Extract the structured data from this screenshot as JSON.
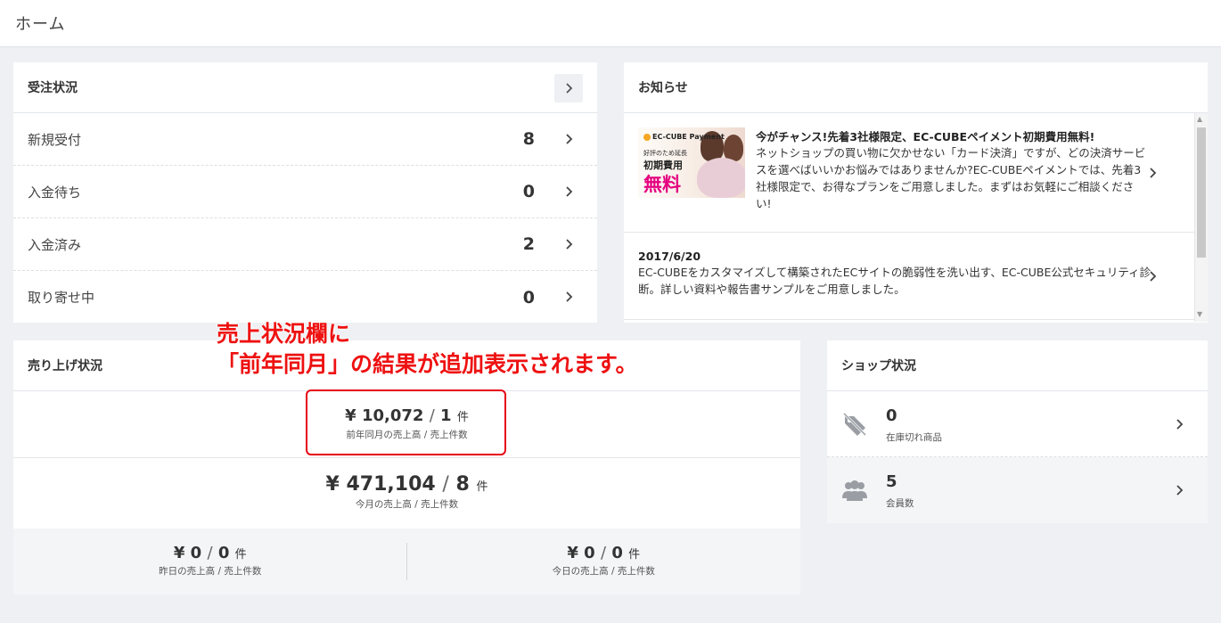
{
  "header": {
    "title": "ホーム"
  },
  "orders": {
    "title": "受注状況",
    "rows": [
      {
        "label": "新規受付",
        "count": "8"
      },
      {
        "label": "入金待ち",
        "count": "0"
      },
      {
        "label": "入金済み",
        "count": "2"
      },
      {
        "label": "取り寄せ中",
        "count": "0"
      }
    ]
  },
  "news": {
    "title": "お知らせ",
    "items": [
      {
        "thumb": {
          "logo": "EC-CUBE Payment",
          "line1": "好評のため延長",
          "line2": "初期費用",
          "line3": "無料"
        },
        "title": "今がチャンス!先着3社様限定、EC-CUBEペイメント初期費用無料!",
        "text": "ネットショップの買い物に欠かせない「カード決済」ですが、どの決済サービスを選べばいいかお悩みではありませんか?EC-CUBEペイメントでは、先着3社様限定で、お得なプランをご用意しました。まずはお気軽にご相談ください!"
      },
      {
        "date": "2017/6/20",
        "text": "EC-CUBEをカスタマイズして構築されたECサイトの脆弱性を洗い出す、EC-CUBE公式セキュリティ診断。詳しい資料や報告書サンプルをご用意しました。"
      }
    ]
  },
  "sales": {
    "title": "売り上げ状況",
    "last_year": {
      "currency": "¥",
      "amount": "10,072",
      "slash": "/",
      "count": "1",
      "unit": "件",
      "label": "前年同月の売上高 / 売上件数"
    },
    "month": {
      "currency": "¥",
      "amount": "471,104",
      "slash": "/",
      "count": "8",
      "unit": "件",
      "label": "今月の売上高 / 売上件数"
    },
    "yesterday": {
      "currency": "¥",
      "amount": "0",
      "slash": "/",
      "count": "0",
      "unit": "件",
      "label": "昨日の売上高 / 売上件数"
    },
    "today": {
      "currency": "¥",
      "amount": "0",
      "slash": "/",
      "count": "0",
      "unit": "件",
      "label": "今日の売上高 / 売上件数"
    }
  },
  "shop": {
    "title": "ショップ状況",
    "rows": [
      {
        "icon": "tag-icon",
        "value": "0",
        "label": "在庫切れ商品"
      },
      {
        "icon": "users-icon",
        "value": "5",
        "label": "会員数"
      }
    ]
  },
  "annotation": {
    "line1": "売上状況欄に",
    "line2": "「前年同月」の結果が追加表示されます。",
    "color": "#ee1111"
  }
}
